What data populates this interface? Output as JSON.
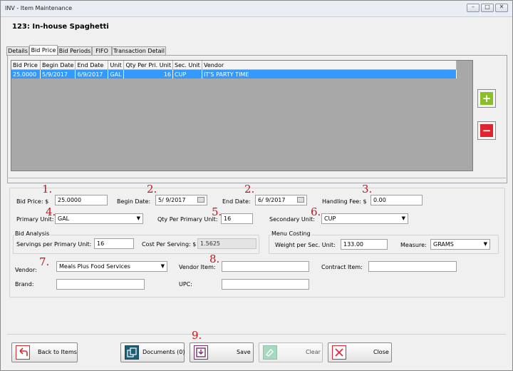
{
  "window": {
    "title": "INV - Item Maintenance"
  },
  "item": {
    "title": "123: In-house Spaghetti"
  },
  "tabs": [
    {
      "label": "Details"
    },
    {
      "label": "Bid Price"
    },
    {
      "label": "Bid Periods"
    },
    {
      "label": "FIFO"
    },
    {
      "label": "Transaction Detail"
    }
  ],
  "grid": {
    "columns": [
      "Bid Price",
      "Begin Date",
      "End Date",
      "Unit",
      "Qty Per Pri. Unit",
      "Sec. Unit",
      "Vendor"
    ],
    "rows": [
      {
        "bid_price": "25.0000",
        "begin_date": "5/9/2017",
        "end_date": "6/9/2017",
        "unit": "GAL",
        "qty": "16",
        "sec_unit": "CUP",
        "vendor": "IT'S PARTY TIME"
      }
    ]
  },
  "form": {
    "bid_price_label": "Bid Price: $",
    "bid_price": "25.0000",
    "begin_date_label": "Begin Date:",
    "begin_date": "5/  9/2017",
    "end_date_label": "End Date:",
    "end_date": "6/  9/2017",
    "handling_fee_label": "Handling Fee: $",
    "handling_fee": "0.00",
    "primary_unit_label": "Primary Unit:",
    "primary_unit": "GAL",
    "qty_per_primary_label": "Qty Per Primary Unit:",
    "qty_per_primary": "16",
    "secondary_unit_label": "Secondary Unit:",
    "secondary_unit": "CUP",
    "bid_analysis_label": "Bid Analysis",
    "servings_label": "Servings per Primary Unit:",
    "servings": "16",
    "cost_per_serving_label": "Cost Per Serving: $",
    "cost_per_serving": "1.5625",
    "menu_costing_label": "Menu Costing",
    "weight_label": "Weight per Sec. Unit:",
    "weight": "133.00",
    "measure_label": "Measure:",
    "measure": "GRAMS",
    "vendor_label": "Vendor:",
    "vendor": "Meals Plus Food Services",
    "vendor_item_label": "Vendor Item:",
    "vendor_item": "",
    "contract_item_label": "Contract Item:",
    "contract_item": "",
    "brand_label": "Brand:",
    "brand": "",
    "upc_label": "UPC:",
    "upc": ""
  },
  "annotations": [
    "1.",
    "2.",
    "2.",
    "3.",
    "4.",
    "5.",
    "6.",
    "7.",
    "8.",
    "9."
  ],
  "buttons": {
    "back": "Back to Items",
    "documents": "Documents (0)",
    "save": "Save",
    "clear": "Clear",
    "close": "Close"
  },
  "colors": {
    "selection": "#3399ff",
    "add_green": "#8bbf2a",
    "remove_red": "#e0242f",
    "annotation_red": "#c0151a"
  }
}
